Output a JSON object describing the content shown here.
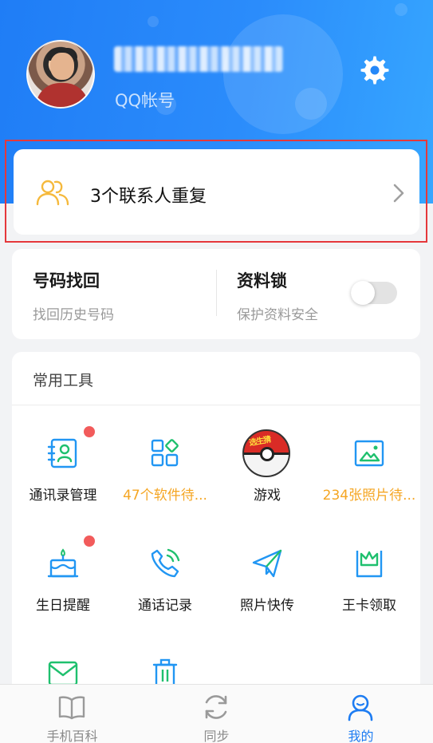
{
  "header": {
    "account_label": "QQ帐号",
    "icons": {
      "settings": "gear-icon"
    }
  },
  "duplicate_banner": {
    "text": "3个联系人重复",
    "icon": "contacts-icon",
    "icon_color": "#f5b93c"
  },
  "security": {
    "recover": {
      "title": "号码找回",
      "subtitle": "找回历史号码"
    },
    "lock": {
      "title": "资料锁",
      "subtitle": "保护资料安全",
      "enabled": false
    }
  },
  "tools": {
    "title": "常用工具",
    "items": [
      {
        "label": "通讯录管理",
        "icon": "address-book-icon",
        "badge": true
      },
      {
        "label": "47个软件待...",
        "icon": "apps-grid-icon",
        "highlight": true
      },
      {
        "label": "游戏",
        "icon": "game-ball-icon",
        "tag": "选生猜"
      },
      {
        "label": "234张照片待...",
        "icon": "photo-icon",
        "highlight": true
      },
      {
        "label": "生日提醒",
        "icon": "birthday-cake-icon",
        "badge": true
      },
      {
        "label": "通话记录",
        "icon": "phone-call-icon"
      },
      {
        "label": "照片快传",
        "icon": "paper-plane-icon"
      },
      {
        "label": "王卡领取",
        "icon": "king-card-icon"
      },
      {
        "label": "",
        "icon": "envelope-icon"
      },
      {
        "label": "",
        "icon": "trash-icon"
      }
    ]
  },
  "bottom_nav": {
    "items": [
      {
        "label": "手机百科",
        "icon": "book-icon",
        "active": false
      },
      {
        "label": "同步",
        "icon": "sync-icon",
        "active": false
      },
      {
        "label": "我的",
        "icon": "profile-icon",
        "active": true
      }
    ]
  },
  "colors": {
    "brand_blue": "#1f7df6",
    "highlight_orange": "#f5a623",
    "badge_red": "#f25b5b",
    "icon_blue": "#2196f3",
    "icon_green": "#1fc06e"
  }
}
